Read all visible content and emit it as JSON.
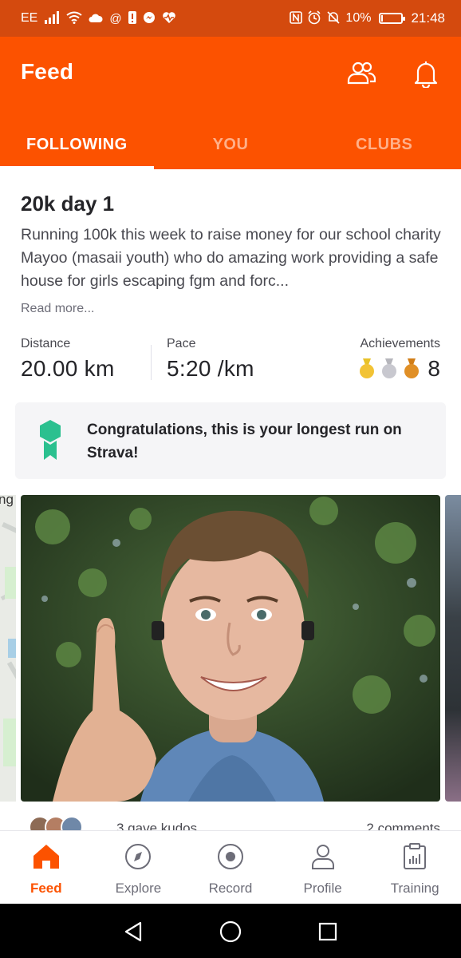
{
  "status_bar": {
    "carrier": "EE",
    "battery": "10%",
    "battery_level": 0.1,
    "time": "21:48"
  },
  "header": {
    "title": "Feed",
    "icons": [
      "people-icon",
      "bell-icon"
    ]
  },
  "tabs": [
    {
      "label": "FOLLOWING",
      "active": true
    },
    {
      "label": "YOU",
      "active": false
    },
    {
      "label": "CLUBS",
      "active": false
    }
  ],
  "activity": {
    "title": "20k day 1",
    "description": "Running 100k this week to raise money for our school charity Mayoo (masaii youth) who do amazing work providing a safe house for girls escaping fgm and forc...",
    "read_more": "Read more...",
    "stats": {
      "distance_label": "Distance",
      "distance_value": "20.00 km",
      "pace_label": "Pace",
      "pace_value": "5:20 /km",
      "achievements_label": "Achievements",
      "achievements_count": "8"
    },
    "congrats": "Congratulations, this is your longest run on Strava!",
    "map_label": "ng",
    "kudos": "3 gave kudos",
    "comments": "2 comments"
  },
  "bottom_nav": [
    {
      "label": "Feed",
      "icon": "home-icon",
      "active": true
    },
    {
      "label": "Explore",
      "icon": "compass-icon",
      "active": false
    },
    {
      "label": "Record",
      "icon": "record-icon",
      "active": false
    },
    {
      "label": "Profile",
      "icon": "person-icon",
      "active": false
    },
    {
      "label": "Training",
      "icon": "clipboard-chart-icon",
      "active": false
    }
  ],
  "colors": {
    "brand": "#fc5200",
    "status_bar": "#d44a0e",
    "congrats_badge": "#2bc08f"
  }
}
